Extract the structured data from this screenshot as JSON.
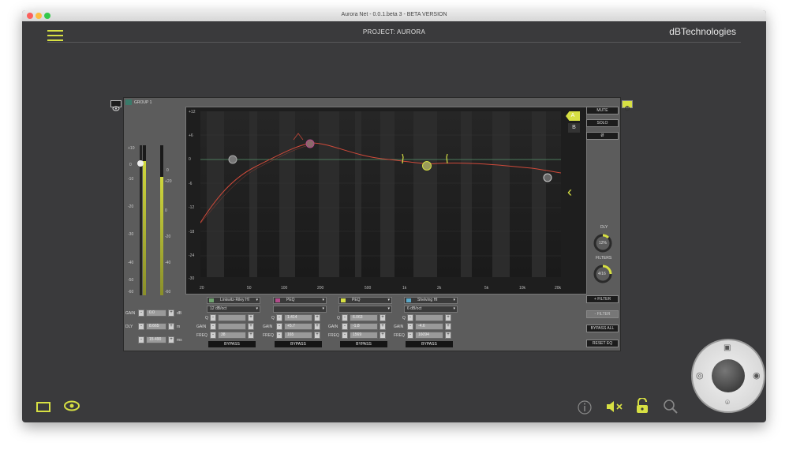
{
  "window": {
    "title": "Aurora Net - 0.0.1.beta 3 - BETA VERSION"
  },
  "header": {
    "project": "PROJECT: AURORA",
    "brand": "dBTechnologies"
  },
  "group": {
    "name": "GROUP 1"
  },
  "eq": {
    "y_ticks": [
      "+12",
      "+6",
      "0",
      "-6",
      "-12",
      "-18",
      "-24",
      "-30"
    ],
    "x_ticks": [
      "20",
      "50",
      "100",
      "200",
      "500",
      "1k",
      "2k",
      "5k",
      "10k",
      "20k"
    ],
    "preset_a": "A",
    "preset_b": "B"
  },
  "meters": {
    "scale_left": [
      "+10",
      "0",
      "-10",
      "-20",
      "-30",
      "-40",
      "-50",
      "-60"
    ],
    "scale_right": [
      "0",
      "+20",
      "0",
      "-20",
      "-40",
      "-60"
    ]
  },
  "left_controls": {
    "gain_label": "GAIN",
    "gain_value": "0.0",
    "gain_unit": "dB",
    "dly_label": "DLY",
    "dly_value": "8.665",
    "dly_unit": "m",
    "ms_value": "15.490",
    "ms_unit": "ms"
  },
  "right_panel": {
    "mute": "MUTE",
    "solo": "SOLO",
    "phase": "Ø",
    "dly_label": "DLY",
    "dly_value": "12%",
    "filters_label": "FILTERS",
    "filters_value": "4/16",
    "add_filter": "+ FILTER",
    "remove_filter": "- FILTER",
    "bypass_all": "BYPASS ALL",
    "reset_eq": "RESET EQ"
  },
  "filters": [
    {
      "type": "Linkwitz-Riley HI",
      "slope": "12 dB/oct",
      "q": "",
      "gain": "",
      "freq": "38",
      "bypass": "BYPASS",
      "color": "#6fa36f"
    },
    {
      "type": "PEQ",
      "slope": "",
      "q": "1.414",
      "gain": "+5.7",
      "freq": "165",
      "bypass": "BYPASS",
      "color": "#b24b8a"
    },
    {
      "type": "PEQ",
      "slope": "",
      "q": "6.063",
      "gain": "-1.8",
      "freq": "1569",
      "bypass": "BYPASS",
      "color": "#d7e043"
    },
    {
      "type": "Shelving HI",
      "slope": "6 dB/oct",
      "q": "",
      "gain": "-4.6",
      "freq": "16094",
      "bypass": "BYPASS",
      "color": "#5aa8c8"
    }
  ],
  "filter_labels": {
    "q": "Q",
    "gain": "GAIN",
    "freq": "FREQ"
  },
  "colors": {
    "accent": "#d7e043",
    "background": "#3a3a3c",
    "curve": "#d04a3a"
  }
}
